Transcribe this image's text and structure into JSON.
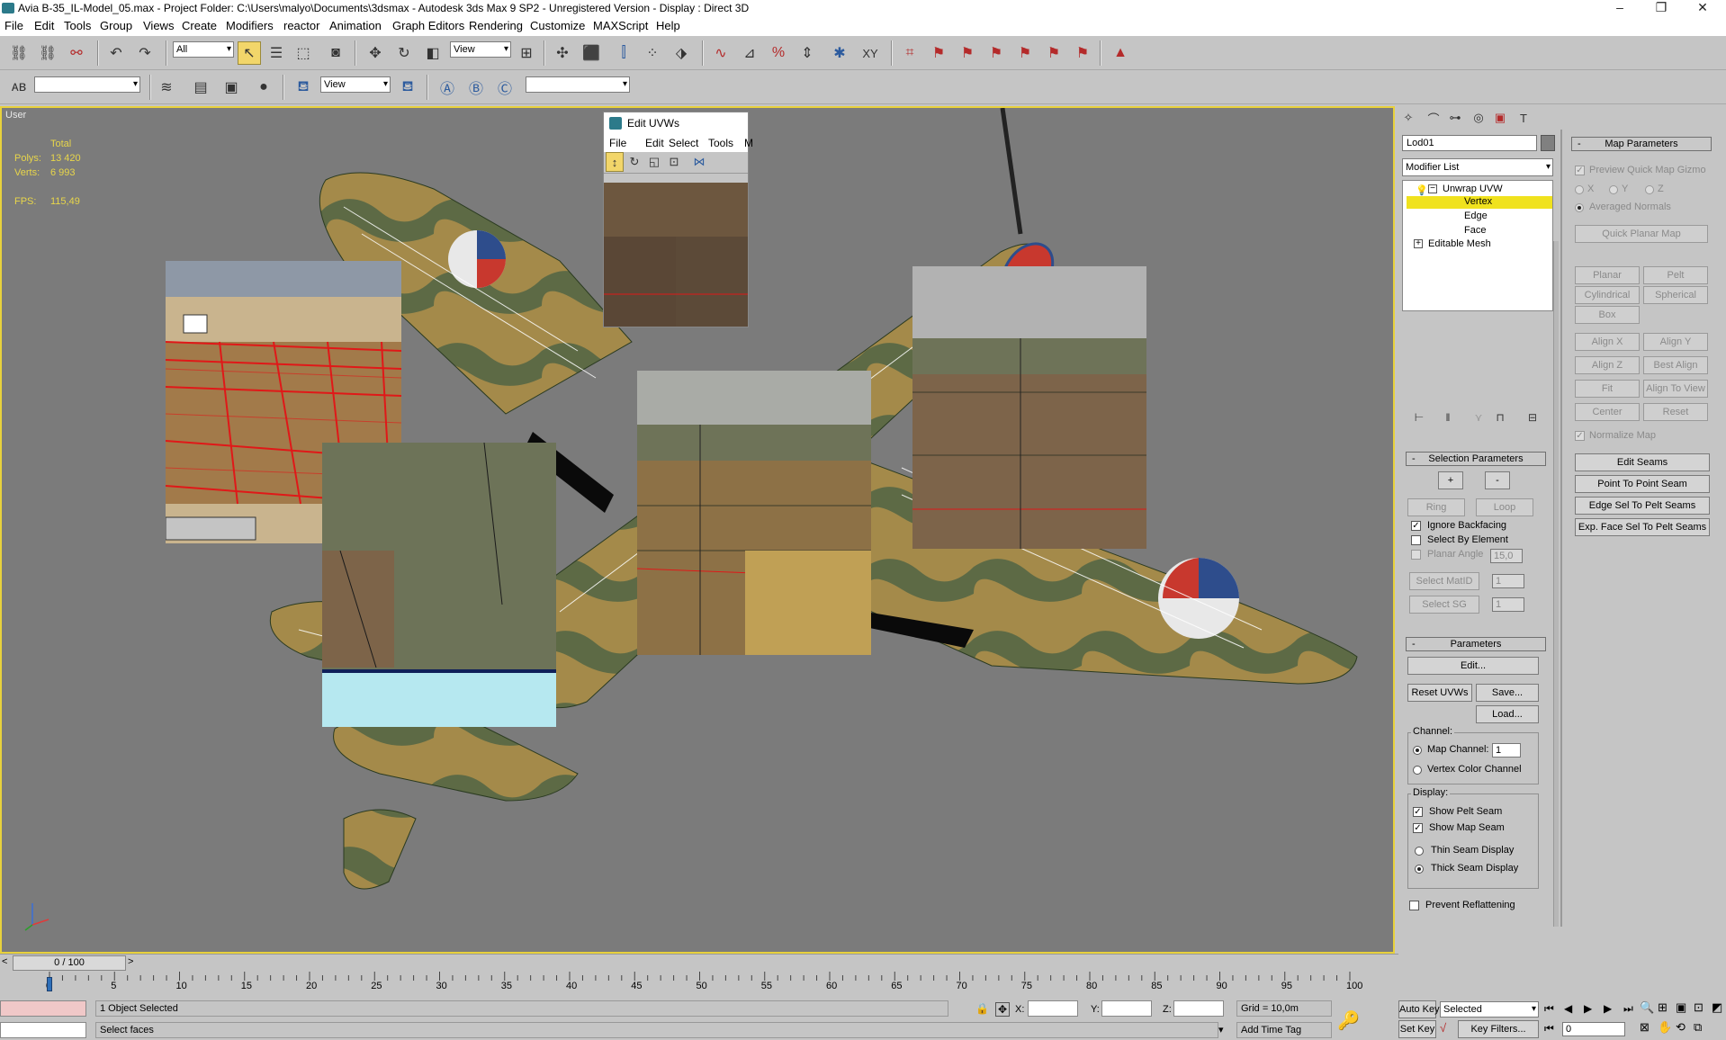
{
  "window": {
    "title": "Avia B-35_IL-Model_05.max    - Project Folder: C:\\Users\\malyo\\Documents\\3dsmax    - Autodesk 3ds Max 9 SP2  - Unregistered Version    - Display : Direct 3D",
    "minimize": "–",
    "maximize": "❐",
    "close": "✕"
  },
  "menubar": [
    "File",
    "Edit",
    "Tools",
    "Group",
    "Views",
    "Create",
    "Modifiers",
    "reactor",
    "Animation",
    "Graph Editors",
    "Rendering",
    "Customize",
    "MAXScript",
    "Help"
  ],
  "toolbar": {
    "selection_filter": "All",
    "ref_coord": "View",
    "layer_dropdown": "",
    "render_view": "View",
    "named_selection": ""
  },
  "viewport": {
    "label": "User",
    "stats": {
      "total_header": "Total",
      "polys_label": "Polys:",
      "polys_value": "13 420",
      "verts_label": "Verts:",
      "verts_value": "6 993",
      "fps_label": "FPS:",
      "fps_value": "115,49"
    }
  },
  "edit_uvws": {
    "title": "Edit UVWs",
    "menu": [
      "File",
      "Edit",
      "Select",
      "Tools",
      "M"
    ]
  },
  "command_panel": {
    "object_name": "Lod01",
    "modifier_list": "Modifier List",
    "stack": [
      {
        "label": "Unwrap UVW",
        "level": 0,
        "expanded": true
      },
      {
        "label": "Vertex",
        "level": 1,
        "selected": true
      },
      {
        "label": "Edge",
        "level": 1
      },
      {
        "label": "Face",
        "level": 1
      },
      {
        "label": "Editable Mesh",
        "level": 0,
        "expanded": false
      }
    ],
    "selection_parameters": {
      "title": "Selection Parameters",
      "plus": "+",
      "minus": "-",
      "ring": "Ring",
      "loop": "Loop",
      "ignore_backfacing": "Ignore Backfacing",
      "select_by_element": "Select By Element",
      "planar_angle": "Planar Angle",
      "planar_angle_value": "15,0",
      "select_matid": "Select MatID",
      "matid_value": "1",
      "select_sg": "Select SG",
      "sg_value": "1"
    },
    "parameters": {
      "title": "Parameters",
      "edit": "Edit...",
      "reset_uvws": "Reset UVWs",
      "save": "Save...",
      "load": "Load...",
      "channel_label": "Channel:",
      "map_channel": "Map Channel:",
      "map_channel_value": "1",
      "vertex_color_channel": "Vertex Color Channel",
      "display_label": "Display:",
      "show_pelt_seam": "Show Pelt Seam",
      "show_map_seam": "Show Map Seam",
      "thin_seam": "Thin Seam Display",
      "thick_seam": "Thick Seam Display",
      "prevent_reflattening": "Prevent Reflattening"
    },
    "map_parameters": {
      "title": "Map Parameters",
      "preview_gizmo": "Preview Quick Map Gizmo",
      "x": "X",
      "y": "Y",
      "z": "Z",
      "averaged_normals": "Averaged Normals",
      "quick_planar_map": "Quick Planar Map",
      "planar": "Planar",
      "pelt": "Pelt",
      "cylindrical": "Cylindrical",
      "spherical": "Spherical",
      "box": "Box",
      "align_x": "Align X",
      "align_y": "Align Y",
      "align_z": "Align Z",
      "best_align": "Best Align",
      "fit": "Fit",
      "align_to_view": "Align To View",
      "center": "Center",
      "reset": "Reset",
      "normalize_map": "Normalize Map",
      "edit_seams": "Edit Seams",
      "point_to_point_seam": "Point To Point Seam",
      "edge_sel_to_pelt": "Edge Sel To Pelt Seams",
      "exp_face_sel": "Exp. Face Sel To Pelt Seams"
    }
  },
  "timeline": {
    "frame_label": "0 / 100",
    "ticks": [
      "0",
      "5",
      "10",
      "15",
      "20",
      "25",
      "30",
      "35",
      "40",
      "45",
      "50",
      "55",
      "60",
      "65",
      "70",
      "75",
      "80",
      "85",
      "90",
      "95",
      "100"
    ]
  },
  "status": {
    "selection": "1 Object Selected",
    "prompt": "Select faces",
    "x_label": "X:",
    "y_label": "Y:",
    "z_label": "Z:",
    "x_value": "",
    "y_value": "",
    "z_value": "",
    "grid": "Grid = 10,0m",
    "add_time_tag": "Add Time Tag",
    "auto_key": "Auto Key",
    "set_key": "Set Key",
    "key_mode": "Selected",
    "key_filters": "Key Filters...",
    "current_frame": "0"
  },
  "colors": {
    "viewport_bg": "#7b7b7b",
    "viewport_border": "#e8d13c",
    "stats_text": "#e8d64a",
    "selected_stack": "#f0e21e",
    "camo_tan": "#a48a4a",
    "camo_green": "#5d6a45",
    "uv_red": "#e01818"
  }
}
